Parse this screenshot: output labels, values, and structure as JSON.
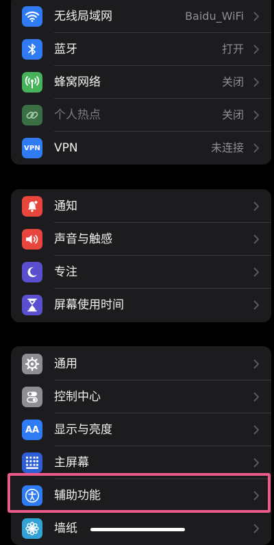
{
  "colors": {
    "wifi": "#2f7bf6",
    "bluetooth": "#2f7bf6",
    "cellular": "#46b35a",
    "hotspot": "#3a6f44",
    "vpn": "#2f7bf6",
    "notifications": "#e8453c",
    "sounds": "#e8453c",
    "focus": "#5a4fcf",
    "screen_time": "#5a4fcf",
    "general": "#8e8e93",
    "control_center": "#8e8e93",
    "display": "#2f7bf6",
    "home_screen": "#2f5fd6",
    "accessibility": "#2f7bf6",
    "wallpaper": "#33a3d6",
    "highlight": "#ea5a8a"
  },
  "groups": [
    {
      "id": "network",
      "items": [
        {
          "label": "无线局域网",
          "value": "Baidu_WiFi",
          "icon": "wifi-icon"
        },
        {
          "label": "蓝牙",
          "value": "打开",
          "icon": "bluetooth-icon"
        },
        {
          "label": "蜂窝网络",
          "value": "关闭",
          "icon": "antenna-icon"
        },
        {
          "label": "个人热点",
          "value": "关闭",
          "icon": "link-icon",
          "disabled": true
        },
        {
          "label": "VPN",
          "value": "未连接",
          "icon": "vpn-icon",
          "icon_text": "VPN"
        }
      ]
    },
    {
      "id": "notify",
      "items": [
        {
          "label": "通知",
          "icon": "bell-icon"
        },
        {
          "label": "声音与触感",
          "icon": "speaker-icon"
        },
        {
          "label": "专注",
          "icon": "moon-icon"
        },
        {
          "label": "屏幕使用时间",
          "icon": "hourglass-icon"
        }
      ]
    },
    {
      "id": "general",
      "items": [
        {
          "label": "通用",
          "icon": "gear-icon"
        },
        {
          "label": "控制中心",
          "icon": "toggles-icon"
        },
        {
          "label": "显示与亮度",
          "icon": "text-size-icon",
          "icon_text": "AA"
        },
        {
          "label": "主屏幕",
          "icon": "app-grid-icon"
        },
        {
          "label": "辅助功能",
          "icon": "accessibility-icon"
        },
        {
          "label": "墙纸",
          "icon": "flower-icon"
        }
      ]
    }
  ]
}
